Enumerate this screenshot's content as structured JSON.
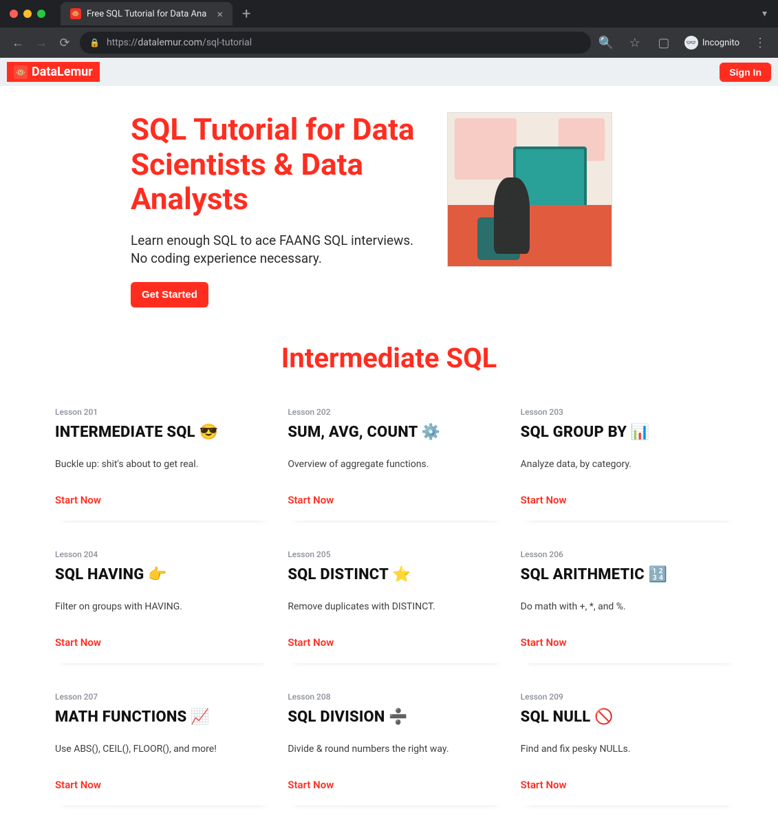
{
  "browser": {
    "tab_title": "Free SQL Tutorial for Data Ana",
    "url_proto": "https://",
    "url_host": "datalemur.com",
    "url_path": "/sql-tutorial",
    "incognito_label": "Incognito"
  },
  "header": {
    "brand": "DataLemur",
    "sign_in": "Sign In"
  },
  "hero": {
    "title": "SQL Tutorial for Data Scientists & Data Analysts",
    "subtitle": "Learn enough SQL to ace FAANG SQL interviews. No coding experience necessary.",
    "cta": "Get Started"
  },
  "section": {
    "title": "Intermediate SQL"
  },
  "lessons": [
    {
      "no": "Lesson 201",
      "title": "INTERMEDIATE SQL 😎",
      "desc": "Buckle up: shit's about to get real."
    },
    {
      "no": "Lesson 202",
      "title": "SUM, AVG, COUNT ⚙️",
      "desc": "Overview of aggregate functions."
    },
    {
      "no": "Lesson 203",
      "title": "SQL GROUP BY 📊",
      "desc": "Analyze data, by category."
    },
    {
      "no": "Lesson 204",
      "title": "SQL HAVING 👉",
      "desc": "Filter on groups with HAVING."
    },
    {
      "no": "Lesson 205",
      "title": "SQL DISTINCT ⭐",
      "desc": "Remove duplicates with DISTINCT."
    },
    {
      "no": "Lesson 206",
      "title": "SQL ARITHMETIC 🔢",
      "desc": "Do math with +, *, and %."
    },
    {
      "no": "Lesson 207",
      "title": "MATH FUNCTIONS 📈",
      "desc": "Use ABS(), CEIL(), FLOOR(), and more!"
    },
    {
      "no": "Lesson 208",
      "title": "SQL DIVISION ➗",
      "desc": "Divide & round numbers the right way."
    },
    {
      "no": "Lesson 209",
      "title": "SQL NULL 🚫",
      "desc": "Find and fix pesky NULLs."
    }
  ],
  "labels": {
    "start_now": "Start Now"
  }
}
